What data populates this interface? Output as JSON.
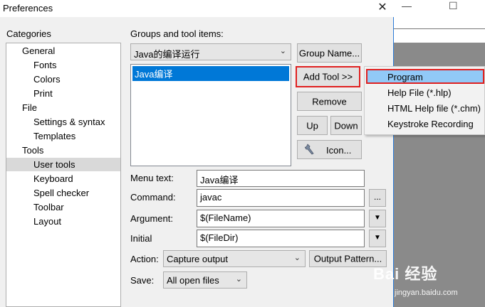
{
  "window": {
    "title": "Preferences",
    "close": "✕"
  },
  "background_app": {
    "minimize": "—",
    "maximize": "☐"
  },
  "categories": {
    "label": "Categories",
    "items": [
      {
        "label": "General",
        "indent": 0
      },
      {
        "label": "Fonts",
        "indent": 1
      },
      {
        "label": "Colors",
        "indent": 1
      },
      {
        "label": "Print",
        "indent": 1
      },
      {
        "label": "File",
        "indent": 0
      },
      {
        "label": "Settings & syntax",
        "indent": 1
      },
      {
        "label": "Templates",
        "indent": 1
      },
      {
        "label": "Tools",
        "indent": 0
      },
      {
        "label": "User tools",
        "indent": 1,
        "selected": true
      },
      {
        "label": "Keyboard",
        "indent": 1
      },
      {
        "label": "Spell checker",
        "indent": 1
      },
      {
        "label": "Toolbar",
        "indent": 1
      },
      {
        "label": "Layout",
        "indent": 1
      }
    ]
  },
  "groups": {
    "label": "Groups and tool items:",
    "selected_group": "Java的编译运行",
    "tool_items": [
      "Java编译"
    ]
  },
  "buttons": {
    "group_name": "Group Name...",
    "add_tool": "Add Tool >>",
    "remove": "Remove",
    "up": "Up",
    "down": "Down",
    "icon": "Icon...",
    "browse": "...",
    "output_pattern": "Output Pattern..."
  },
  "form": {
    "menu_text": {
      "label": "Menu text:",
      "value": "Java编译"
    },
    "command": {
      "label": "Command:",
      "value": "javac"
    },
    "argument": {
      "label": "Argument:",
      "value": "$(FileName)"
    },
    "initial": {
      "label": "Initial",
      "value": "$(FileDir)"
    },
    "action": {
      "label": "Action:",
      "value": "Capture output"
    },
    "save": {
      "label": "Save:",
      "value": "All open files"
    }
  },
  "add_tool_menu": {
    "items": [
      "Program",
      "Help File (*.hlp)",
      "HTML Help file (*.chm)",
      "Keystroke Recording"
    ],
    "highlighted": "Program"
  },
  "watermark": {
    "brand": "Bai 经验",
    "url": "jingyan.baidu.com"
  },
  "colors": {
    "selection": "#0078d7",
    "highlight_frame": "#e02020",
    "menu_highlight": "#91c9f7"
  }
}
